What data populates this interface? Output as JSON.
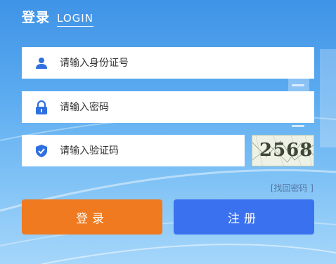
{
  "header": {
    "title_cn": "登录",
    "title_en": "LOGIN"
  },
  "fields": {
    "id_placeholder": "请输入身份证号",
    "password_placeholder": "请输入密码",
    "captcha_placeholder": "请输入验证码"
  },
  "captcha": {
    "code": "2568"
  },
  "links": {
    "forgot_password": "[找回密码 ]"
  },
  "buttons": {
    "login": "登录",
    "register": "注册"
  },
  "colors": {
    "login_button": "#f07a1f",
    "register_button": "#3a71ee",
    "icon_blue": "#2f6fe0",
    "background": "#5aaaf0"
  }
}
